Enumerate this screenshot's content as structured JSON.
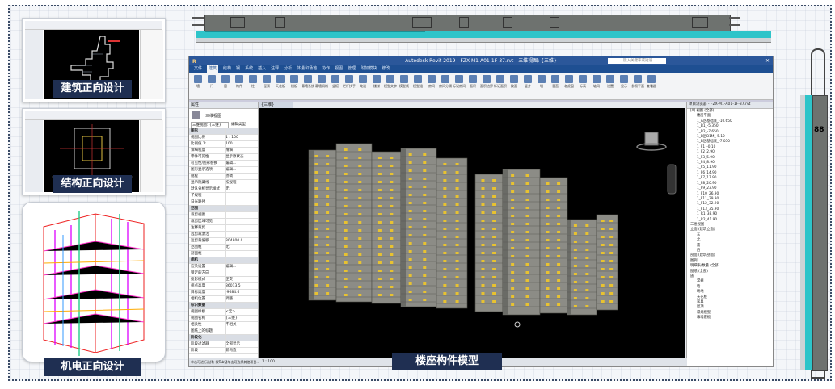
{
  "thumbnails": {
    "architecture_caption": "建筑正向设计",
    "structure_caption": "结构正向设计",
    "mep_caption": "机电正向设计"
  },
  "revit": {
    "title": "Autodesk Revit 2019 - FZX-M1-A01-1F-37.rvt - 三维视图: {三维}",
    "search_placeholder": "键入关键字或短语",
    "tabs": [
      "文件",
      "建筑",
      "结构",
      "钢",
      "系统",
      "插入",
      "注释",
      "分析",
      "体量和场地",
      "协作",
      "视图",
      "管理",
      "附加模块",
      "修改"
    ],
    "ribbon_buttons": [
      "墙",
      "门",
      "窗",
      "构件",
      "柱",
      "屋顶",
      "天花板",
      "楼板",
      "幕墙系统",
      "幕墙网格",
      "竖梃",
      "栏杆扶手",
      "坡道",
      "楼梯",
      "模型文字",
      "模型线",
      "模型组",
      "房间",
      "房间分隔",
      "标记房间",
      "面积",
      "面积边界",
      "标记面积",
      "按面",
      "竖井",
      "墙",
      "垂直",
      "老虎窗",
      "标高",
      "轴网",
      "设置",
      "显示",
      "参照平面",
      "查看器"
    ],
    "ribbon_groups": [
      "构建",
      "楼梯坡道",
      "模型",
      "房间和面积",
      "洞口",
      "基准",
      "工作平面"
    ],
    "properties": {
      "header": "属性",
      "type_name": "三维视图",
      "selector": "三维视图: {三维}",
      "edit_type": "编辑类型",
      "rows": [
        {
          "k": "图形",
          "v": "",
          "sec": true
        },
        {
          "k": "视图比例",
          "v": "1 : 100"
        },
        {
          "k": "比例值 1:",
          "v": "100"
        },
        {
          "k": "详细程度",
          "v": "精细"
        },
        {
          "k": "零件可见性",
          "v": "显示原状态"
        },
        {
          "k": "可见性/图形替换",
          "v": "编辑..."
        },
        {
          "k": "图形显示选项",
          "v": "编辑..."
        },
        {
          "k": "规程",
          "v": "协调"
        },
        {
          "k": "显示隐藏线",
          "v": "按规程"
        },
        {
          "k": "默认分析显示样式",
          "v": "无"
        },
        {
          "k": "子规程",
          "v": ""
        },
        {
          "k": "日光路径",
          "v": ""
        },
        {
          "k": "范围",
          "v": "",
          "sec": true
        },
        {
          "k": "裁剪视图",
          "v": ""
        },
        {
          "k": "裁剪区域可见",
          "v": ""
        },
        {
          "k": "注释裁剪",
          "v": ""
        },
        {
          "k": "远剪裁激活",
          "v": ""
        },
        {
          "k": "远剪裁偏移",
          "v": "304800.0"
        },
        {
          "k": "范围框",
          "v": "无"
        },
        {
          "k": "剖面框",
          "v": ""
        },
        {
          "k": "相机",
          "v": "",
          "sec": true
        },
        {
          "k": "渲染设置",
          "v": "编辑..."
        },
        {
          "k": "锁定的方向",
          "v": ""
        },
        {
          "k": "投影模式",
          "v": "正交"
        },
        {
          "k": "视点高度",
          "v": "86013.5"
        },
        {
          "k": "目标高度",
          "v": "-9684.6"
        },
        {
          "k": "相机位置",
          "v": "调整"
        },
        {
          "k": "标识数据",
          "v": "",
          "sec": true
        },
        {
          "k": "视图样板",
          "v": "<无>"
        },
        {
          "k": "视图名称",
          "v": "{三维}"
        },
        {
          "k": "相关性",
          "v": "不相关"
        },
        {
          "k": "图纸上的标题",
          "v": ""
        },
        {
          "k": "阶段化",
          "v": "",
          "sec": true
        },
        {
          "k": "阶段过滤器",
          "v": "全部显示"
        },
        {
          "k": "阶段",
          "v": "新构造"
        }
      ],
      "help_link": "属性帮助",
      "apply": "应用"
    },
    "view_tab": "{三维}",
    "browser": {
      "header": "项目浏览器 - FZX-M1-A01-1F-37.rvt",
      "items": [
        "[0] 视图 (全部)",
        "楼层平面",
        "1_A区基础底_-10.650",
        "1_B1_-5.350",
        "1_B2_-7.650",
        "1_B区B1M_-5.10",
        "1_B区基础底_-7.050",
        "1_F1_-0.10",
        "1_F2_2.90",
        "1_F3_5.90",
        "1_F4_8.90",
        "1_F5_11.90",
        "1_F6_14.90",
        "1_F7_17.90",
        "1_F8_20.90",
        "1_F9_23.90",
        "1_F10_26.90",
        "1_F11_29.90",
        "1_F12_32.90",
        "1_F13_35.90",
        "1_R1_38.90",
        "1_R2_41.90",
        "三维视图",
        "立面 (建筑立面)",
        "东",
        "北",
        "南",
        "西",
        "剖面 (建筑剖面)",
        "图例",
        "明细表/数量 (全部)",
        "图纸 (全部)",
        "族",
        "常规",
        "墙",
        "场地",
        "天花板",
        "家具",
        "屋顶",
        "常规模型",
        "幕墙嵌板"
      ]
    },
    "status": {
      "scale": "1 : 100",
      "hint": "单击可进行选择; 按Tab键单击可选择其他项目..."
    }
  },
  "main_caption": "楼座构件模型"
}
